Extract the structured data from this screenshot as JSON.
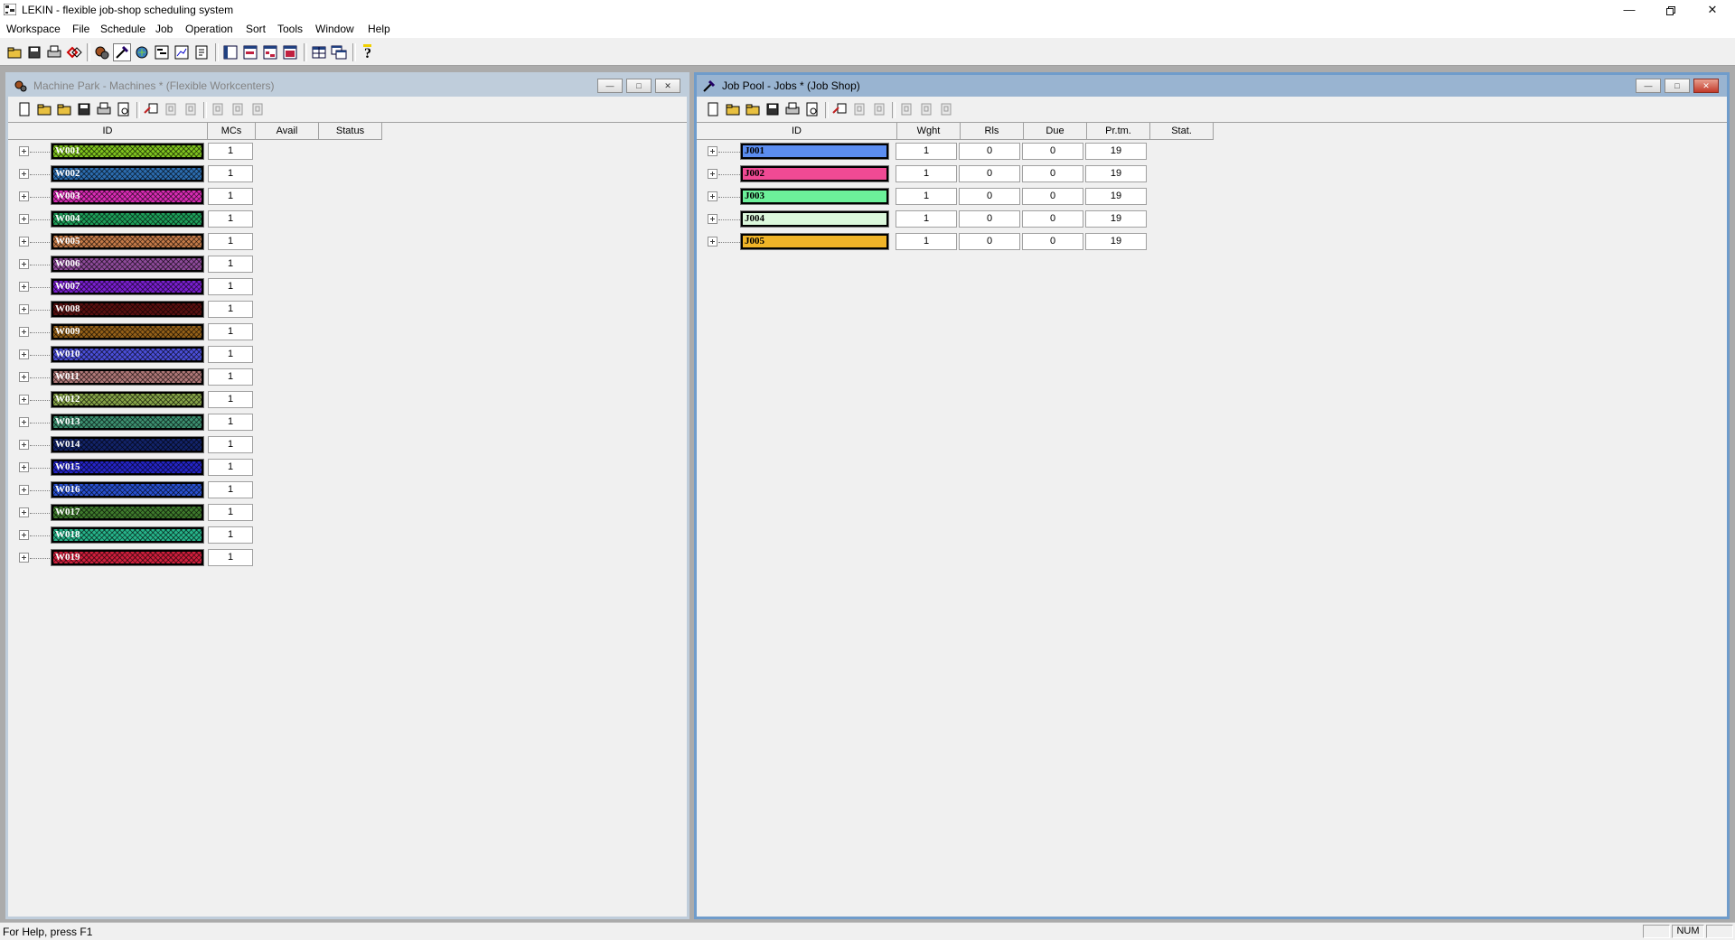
{
  "app": {
    "title": "LEKIN - flexible job-shop scheduling system",
    "window_controls": [
      "minimize-icon",
      "restore-icon",
      "close-icon"
    ]
  },
  "menu": [
    "Workspace",
    "File",
    "Schedule",
    "Job",
    "Operation",
    "Sort",
    "Tools",
    "Window",
    "Help"
  ],
  "toolbar_icons": [
    "open-workspace-icon",
    "save-workspace-icon",
    "print-icon",
    "sequence-icon",
    "machine-icon",
    "job-icon",
    "schedule-icon",
    "gantt-icon",
    "chart-icon",
    "log-icon",
    "machine-gantt-icon",
    "job-gantt-icon",
    "tile-icon",
    "cascade-icon",
    "table-icon",
    "window-icon",
    "help-icon"
  ],
  "machine_window": {
    "title": "Machine Park - Machines * (Flexible Workcenters)",
    "active": false,
    "columns": [
      "ID",
      "MCs",
      "Avail",
      "Status"
    ],
    "rows": [
      {
        "id": "W001",
        "mcs": "1",
        "color": "#7fc41e",
        "textdark": false
      },
      {
        "id": "W002",
        "mcs": "1",
        "color": "#2c6db0",
        "textdark": false
      },
      {
        "id": "W003",
        "mcs": "1",
        "color": "#d82bb4",
        "textdark": false
      },
      {
        "id": "W004",
        "mcs": "1",
        "color": "#1ea05a",
        "textdark": false
      },
      {
        "id": "W005",
        "mcs": "1",
        "color": "#c47a48",
        "textdark": false
      },
      {
        "id": "W006",
        "mcs": "1",
        "color": "#8e4a9a",
        "textdark": false
      },
      {
        "id": "W007",
        "mcs": "1",
        "color": "#7a1ed0",
        "textdark": false
      },
      {
        "id": "W008",
        "mcs": "1",
        "color": "#5a1010",
        "textdark": false
      },
      {
        "id": "W009",
        "mcs": "1",
        "color": "#946018",
        "textdark": false
      },
      {
        "id": "W010",
        "mcs": "1",
        "color": "#4a4ed8",
        "textdark": false
      },
      {
        "id": "W011",
        "mcs": "1",
        "color": "#b07878",
        "textdark": false
      },
      {
        "id": "W012",
        "mcs": "1",
        "color": "#86a448",
        "textdark": false
      },
      {
        "id": "W013",
        "mcs": "1",
        "color": "#3c9070",
        "textdark": false
      },
      {
        "id": "W014",
        "mcs": "1",
        "color": "#12236a",
        "textdark": false
      },
      {
        "id": "W015",
        "mcs": "1",
        "color": "#2424c8",
        "textdark": false
      },
      {
        "id": "W016",
        "mcs": "1",
        "color": "#2850d0",
        "textdark": false
      },
      {
        "id": "W017",
        "mcs": "1",
        "color": "#3e7a2c",
        "textdark": false
      },
      {
        "id": "W018",
        "mcs": "1",
        "color": "#26b48a",
        "textdark": false
      },
      {
        "id": "W019",
        "mcs": "1",
        "color": "#d01e3c",
        "textdark": false
      }
    ]
  },
  "job_window": {
    "title": "Job Pool - Jobs * (Job Shop)",
    "active": true,
    "columns": [
      "ID",
      "Wght",
      "Rls",
      "Due",
      "Pr.tm.",
      "Stat."
    ],
    "rows": [
      {
        "id": "J001",
        "wght": "1",
        "rls": "0",
        "due": "0",
        "prtm": "19",
        "color": "#5b8df0",
        "textdark": true
      },
      {
        "id": "J002",
        "wght": "1",
        "rls": "0",
        "due": "0",
        "prtm": "19",
        "color": "#f04a94",
        "textdark": true
      },
      {
        "id": "J003",
        "wght": "1",
        "rls": "0",
        "due": "0",
        "prtm": "19",
        "color": "#6cf09a",
        "textdark": true
      },
      {
        "id": "J004",
        "wght": "1",
        "rls": "0",
        "due": "0",
        "prtm": "19",
        "color": "#dcf8dc",
        "textdark": true
      },
      {
        "id": "J005",
        "wght": "1",
        "rls": "0",
        "due": "0",
        "prtm": "19",
        "color": "#f0b428",
        "textdark": true
      }
    ]
  },
  "statusbar": {
    "text": "For Help, press F1",
    "num": "NUM"
  }
}
